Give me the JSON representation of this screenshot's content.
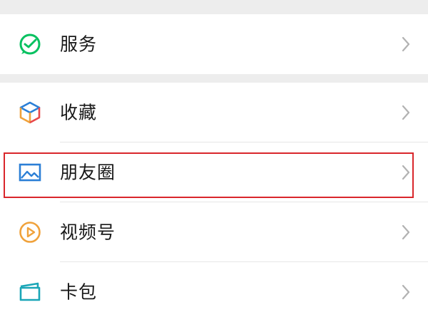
{
  "menu": {
    "services": {
      "label": "服务",
      "icon": "wechat-pay-icon"
    },
    "items": [
      {
        "key": "favorites",
        "label": "收藏",
        "icon": "favorites-cube-icon"
      },
      {
        "key": "moments",
        "label": "朋友圈",
        "icon": "moments-image-icon",
        "highlighted": true
      },
      {
        "key": "channels",
        "label": "视频号",
        "icon": "channels-play-icon"
      },
      {
        "key": "cards",
        "label": "卡包",
        "icon": "card-wallet-icon"
      }
    ]
  },
  "colors": {
    "background": "#ededed",
    "row": "#ffffff",
    "text": "#191919",
    "chevron": "#b2b2b2",
    "highlight_border": "#d9262b",
    "services_green": "#07c160",
    "moments_blue": "#2b7fd6",
    "channels_orange": "#f0a23b",
    "cards_teal": "#1aa6b7"
  }
}
